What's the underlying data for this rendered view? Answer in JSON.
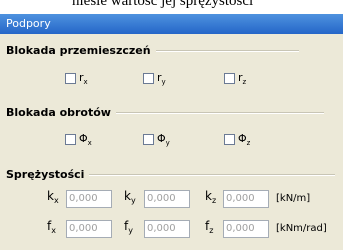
{
  "top_cut_text": "niesie wartość jej sprężystości",
  "window": {
    "title": "Podpory"
  },
  "displacement_group": {
    "title": "Blokada przemieszczeń",
    "options": [
      {
        "base": "r",
        "sub": "x",
        "checked": false
      },
      {
        "base": "r",
        "sub": "y",
        "checked": false
      },
      {
        "base": "r",
        "sub": "z",
        "checked": false
      }
    ]
  },
  "rotation_group": {
    "title": "Blokada obrotów",
    "options": [
      {
        "base": "Φ",
        "sub": "x",
        "checked": false
      },
      {
        "base": "Φ",
        "sub": "y",
        "checked": false
      },
      {
        "base": "Φ",
        "sub": "z",
        "checked": false
      }
    ]
  },
  "stiffness_group": {
    "title": "Sprężystości",
    "k_row": {
      "fields": [
        {
          "base": "k",
          "sub": "x",
          "value": "0,000"
        },
        {
          "base": "k",
          "sub": "y",
          "value": "0,000"
        },
        {
          "base": "k",
          "sub": "z",
          "value": "0,000"
        }
      ],
      "unit": "[kN/m]"
    },
    "f_row": {
      "fields": [
        {
          "base": "f",
          "sub": "x",
          "value": "0,000"
        },
        {
          "base": "f",
          "sub": "y",
          "value": "0,000"
        },
        {
          "base": "f",
          "sub": "z",
          "value": "0,000"
        }
      ],
      "unit": "[kNm/rad]"
    }
  }
}
